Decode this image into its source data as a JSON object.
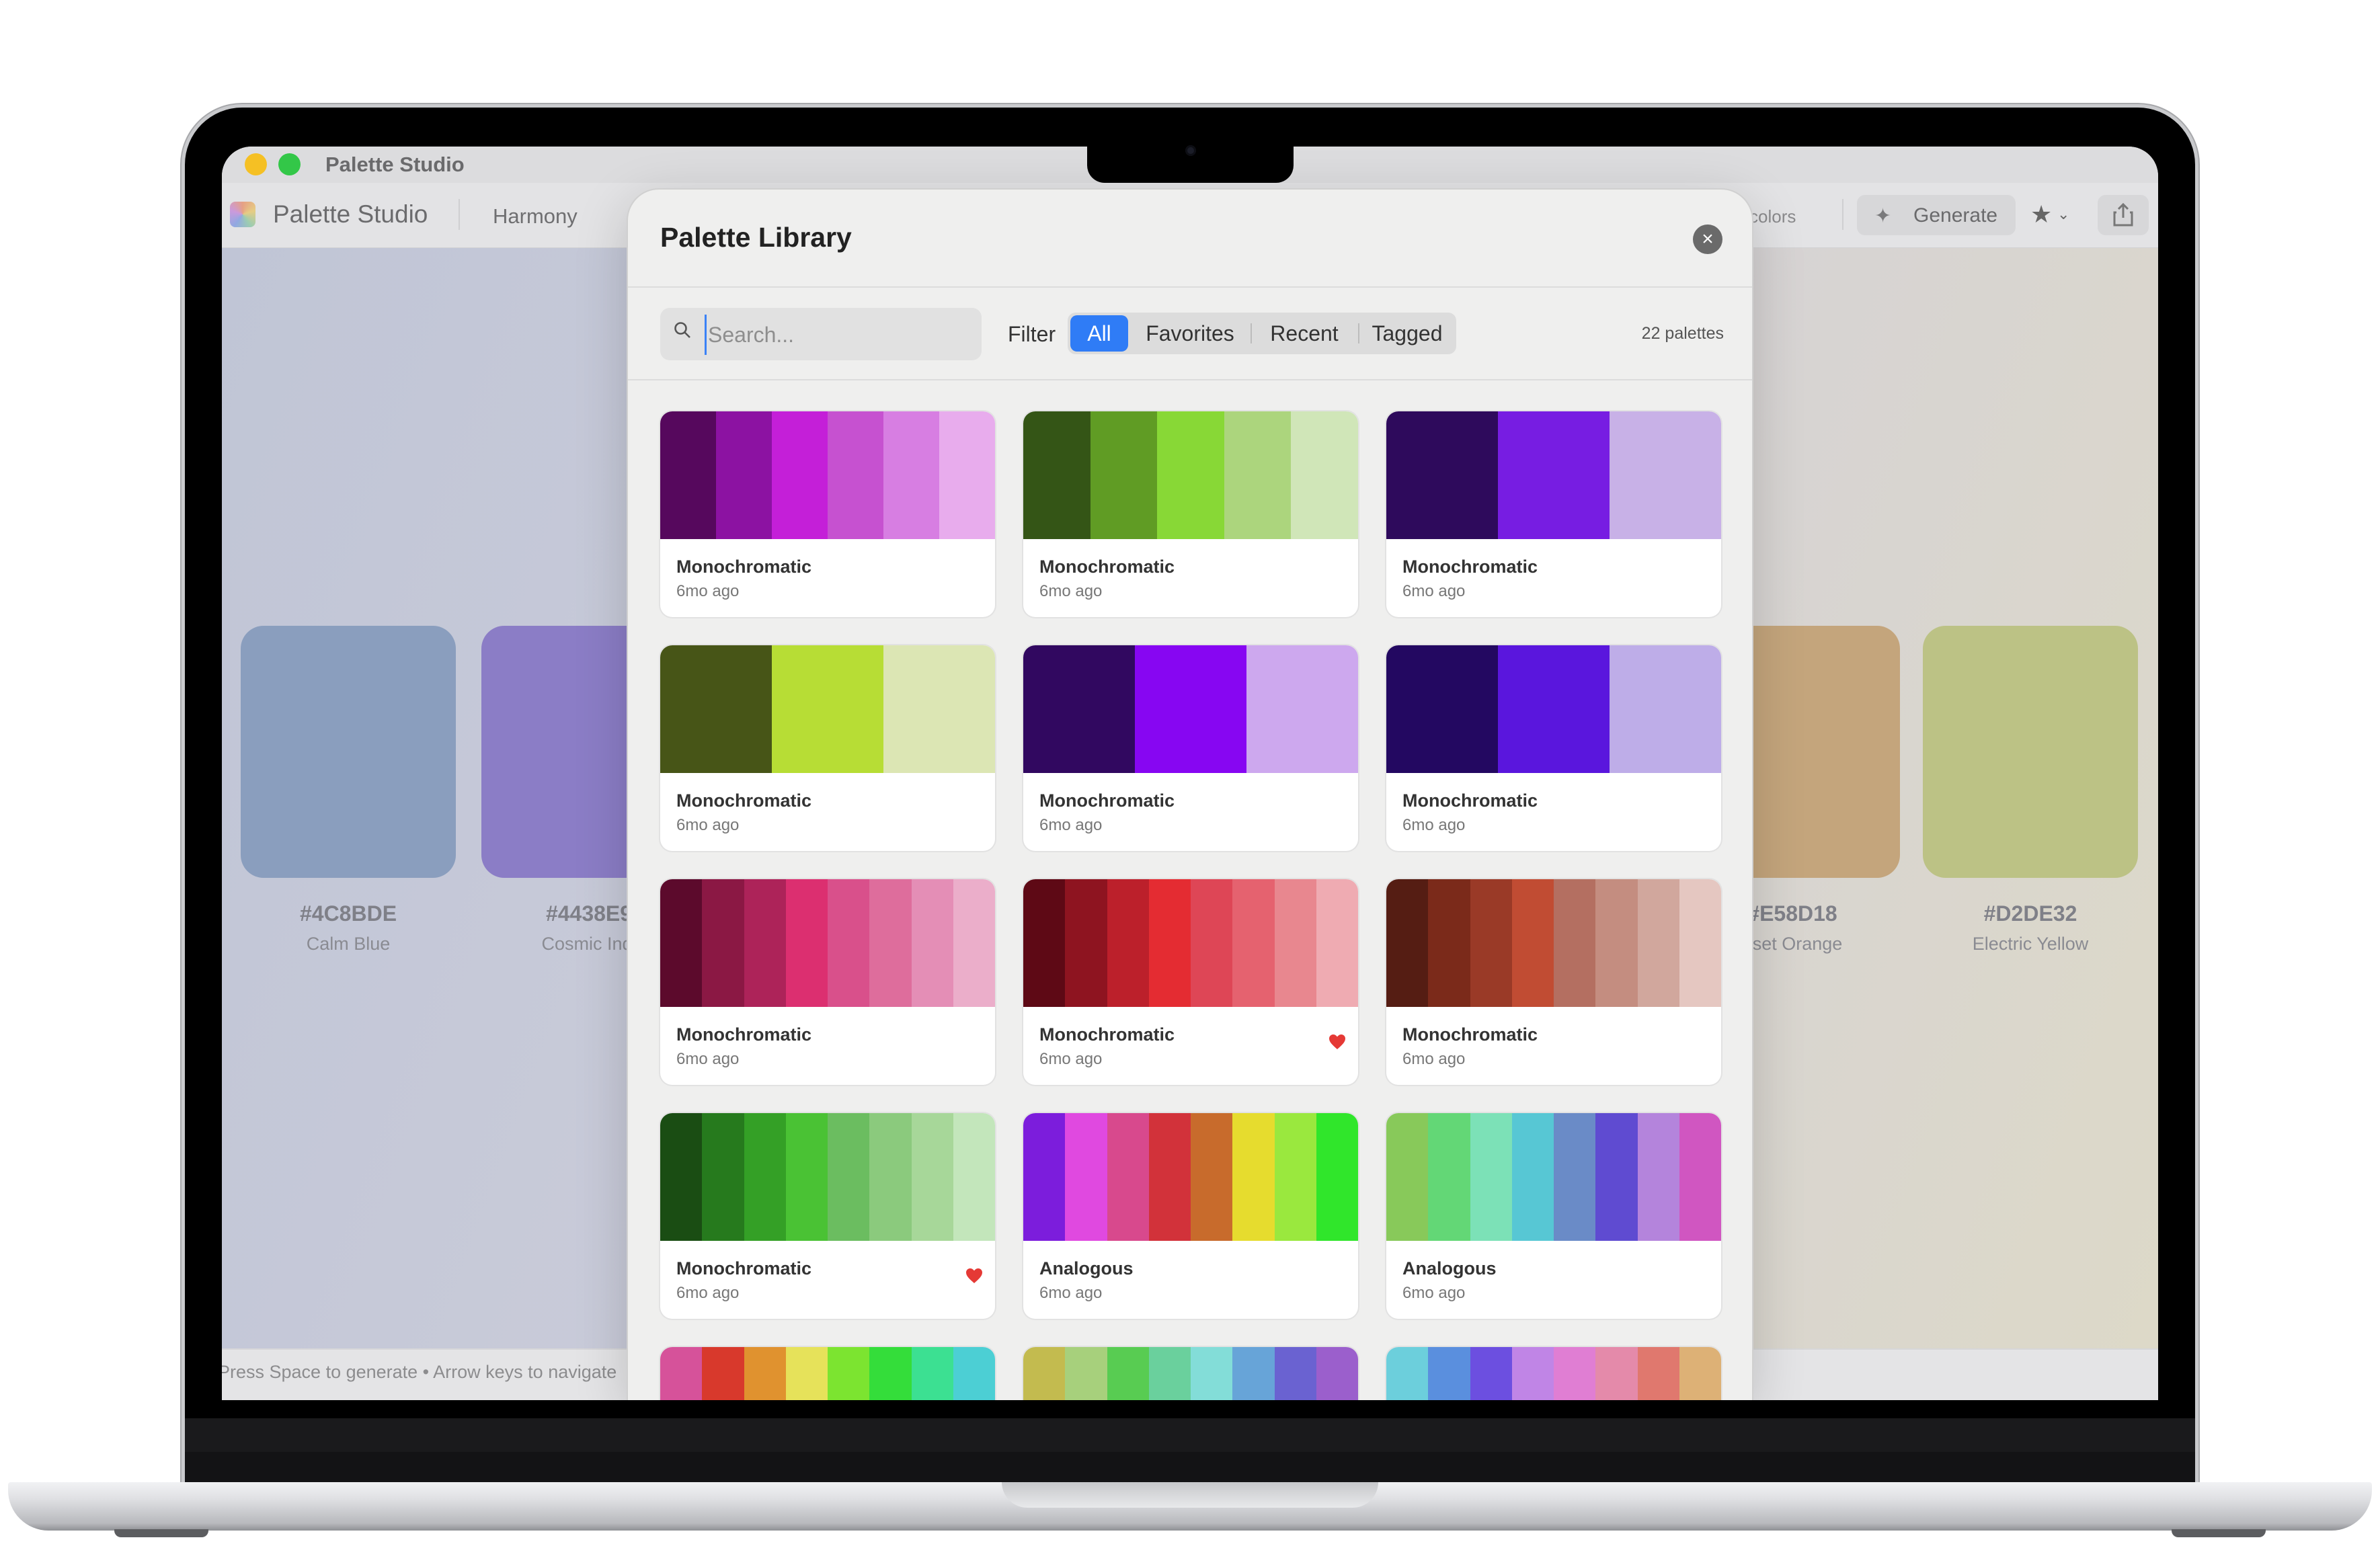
{
  "window": {
    "title": "Palette Studio"
  },
  "toolbar": {
    "app_name": "Palette Studio",
    "harmony_label": "Harmony",
    "colors_label": "colors",
    "generate_label": "Generate"
  },
  "swatches": [
    {
      "hex": "#4C8BDE",
      "name": "Calm Blue",
      "color": "#8a9ebe"
    },
    {
      "hex": "#4438E9",
      "name": "Cosmic Indi",
      "color": "#8b7dc6"
    },
    {
      "hex": "#E58D18",
      "name": "nset Orange",
      "color": "#c4a57c"
    },
    {
      "hex": "#D2DE32",
      "name": "Electric Yellow",
      "color": "#bcc285"
    }
  ],
  "status": {
    "hint": "Press Space to generate • Arrow keys to navigate"
  },
  "modal": {
    "title": "Palette Library",
    "search_placeholder": "Search...",
    "filter_label": "Filter",
    "filters": [
      "All",
      "Favorites",
      "Recent",
      "Tagged"
    ],
    "active_filter": "All",
    "count": "22 palettes",
    "palettes": [
      {
        "name": "Monochromatic",
        "date": "6mo ago",
        "favorite": false,
        "colors": [
          "#56085d",
          "#8c12a2",
          "#c41fd8",
          "#c651d0",
          "#d77ee2",
          "#e8aced"
        ]
      },
      {
        "name": "Monochromatic",
        "date": "6mo ago",
        "favorite": false,
        "colors": [
          "#345516",
          "#609c24",
          "#88d836",
          "#acd57d",
          "#d0e6b8"
        ]
      },
      {
        "name": "Monochromatic",
        "date": "6mo ago",
        "favorite": false,
        "colors": [
          "#2e0a5c",
          "#771de2",
          "#c8b1e7"
        ]
      },
      {
        "name": "Monochromatic",
        "date": "6mo ago",
        "favorite": false,
        "colors": [
          "#475517",
          "#b7dd35",
          "#dce6b4"
        ]
      },
      {
        "name": "Monochromatic",
        "date": "6mo ago",
        "favorite": false,
        "colors": [
          "#310860",
          "#8706f2",
          "#cda8ee"
        ]
      },
      {
        "name": "Monochromatic",
        "date": "6mo ago",
        "favorite": false,
        "colors": [
          "#230861",
          "#5a16dd",
          "#beade8"
        ]
      },
      {
        "name": "Monochromatic",
        "date": "6mo ago",
        "favorite": false,
        "colors": [
          "#5c0a2c",
          "#8b1844",
          "#ad2359",
          "#dc2f70",
          "#d9508b",
          "#de6d9c",
          "#e48eb6",
          "#ebaeca"
        ]
      },
      {
        "name": "Monochromatic",
        "date": "6mo ago",
        "favorite": true,
        "colors": [
          "#5e0915",
          "#8e1420",
          "#bc202b",
          "#e42c32",
          "#de4656",
          "#e5626f",
          "#e8878f",
          "#efabb2"
        ]
      },
      {
        "name": "Monochromatic",
        "date": "6mo ago",
        "favorite": false,
        "colors": [
          "#551d13",
          "#7b2a1a",
          "#9a3a27",
          "#c14c33",
          "#b46f61",
          "#c48d80",
          "#d1a79d",
          "#e5c7c1"
        ]
      },
      {
        "name": "Monochromatic",
        "date": "6mo ago",
        "favorite": true,
        "colors": [
          "#1a4d13",
          "#267a1d",
          "#34a026",
          "#4ac234",
          "#6bbd60",
          "#8bca7d",
          "#a7d799",
          "#c3e6bb"
        ]
      },
      {
        "name": "Analogous",
        "date": "6mo ago",
        "favorite": false,
        "colors": [
          "#7c1ddc",
          "#e049e0",
          "#d8498d",
          "#d2323a",
          "#c86b2c",
          "#e6dc2e",
          "#9ae83e",
          "#30e62b"
        ]
      },
      {
        "name": "Analogous",
        "date": "6mo ago",
        "favorite": false,
        "colors": [
          "#88c95a",
          "#63d776",
          "#7ce1b7",
          "#57c7d4",
          "#6a8bc7",
          "#5f4bd1",
          "#b484dc",
          "#d056c1"
        ]
      },
      {
        "name": "",
        "date": "",
        "favorite": false,
        "colors": [
          "#d6529a",
          "#d8392c",
          "#e0922f",
          "#e6e25a",
          "#7ce430",
          "#34dd3a",
          "#3ce092",
          "#4ccfd4"
        ]
      },
      {
        "name": "",
        "date": "",
        "favorite": false,
        "colors": [
          "#c3bb4f",
          "#a7d07c",
          "#58cc52",
          "#6ad09d",
          "#83ddd8",
          "#67a4d8",
          "#6a62d1",
          "#9b5fcc"
        ]
      },
      {
        "name": "",
        "date": "",
        "favorite": false,
        "colors": [
          "#6ccfdc",
          "#5a8fde",
          "#6c4fe0",
          "#c085e6",
          "#e07ed3",
          "#e48aaa",
          "#e0786e",
          "#ddb176"
        ]
      }
    ]
  },
  "colors": {
    "accent": "#2f7cf6",
    "heart": "#e53935"
  }
}
